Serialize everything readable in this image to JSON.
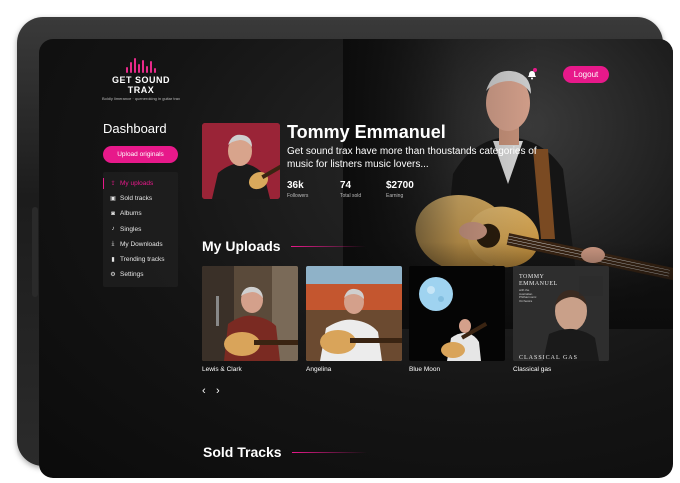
{
  "app": {
    "logo_name": "GET SOUND TRAX",
    "logo_tagline": "Boldly limerance · queneroking in guitar trax",
    "logout_label": "Logout"
  },
  "sidebar": {
    "title": "Dashboard",
    "upload_label": "Upload originals",
    "items": [
      {
        "label": "My uploads",
        "icon": "upload-icon",
        "active": true
      },
      {
        "label": "Sold tracks",
        "icon": "cart-icon",
        "active": false
      },
      {
        "label": "Albums",
        "icon": "album-icon",
        "active": false
      },
      {
        "label": "Singles",
        "icon": "music-note-icon",
        "active": false
      },
      {
        "label": "My Downloads",
        "icon": "download-icon",
        "active": false
      },
      {
        "label": "Trending tracks",
        "icon": "trending-icon",
        "active": false
      },
      {
        "label": "Settings",
        "icon": "gear-icon",
        "active": false
      }
    ]
  },
  "profile": {
    "name": "Tommy Emmanuel",
    "description": "Get sound trax have more than thoustands categories of music for listners music lovers...",
    "stats": [
      {
        "value": "36k",
        "label": "Followers"
      },
      {
        "value": "74",
        "label": "Total sold"
      },
      {
        "value": "$2700",
        "label": "Earning"
      }
    ]
  },
  "uploads": {
    "title": "My Uploads",
    "items": [
      {
        "title": "Lewis & Clark"
      },
      {
        "title": "Angelina"
      },
      {
        "title": "Blue Moon"
      },
      {
        "title": "Classical gas",
        "cover_text_top": "TOMMY",
        "cover_text_name": "EMMANUEL",
        "cover_text_bottom": "CLASSICAL GAS",
        "cover_small": "with the Australian Philharmonic Orchestra"
      }
    ]
  },
  "sold": {
    "title": "Sold Tracks"
  },
  "colors": {
    "accent": "#e7198a",
    "background": "#0f0f0f"
  }
}
